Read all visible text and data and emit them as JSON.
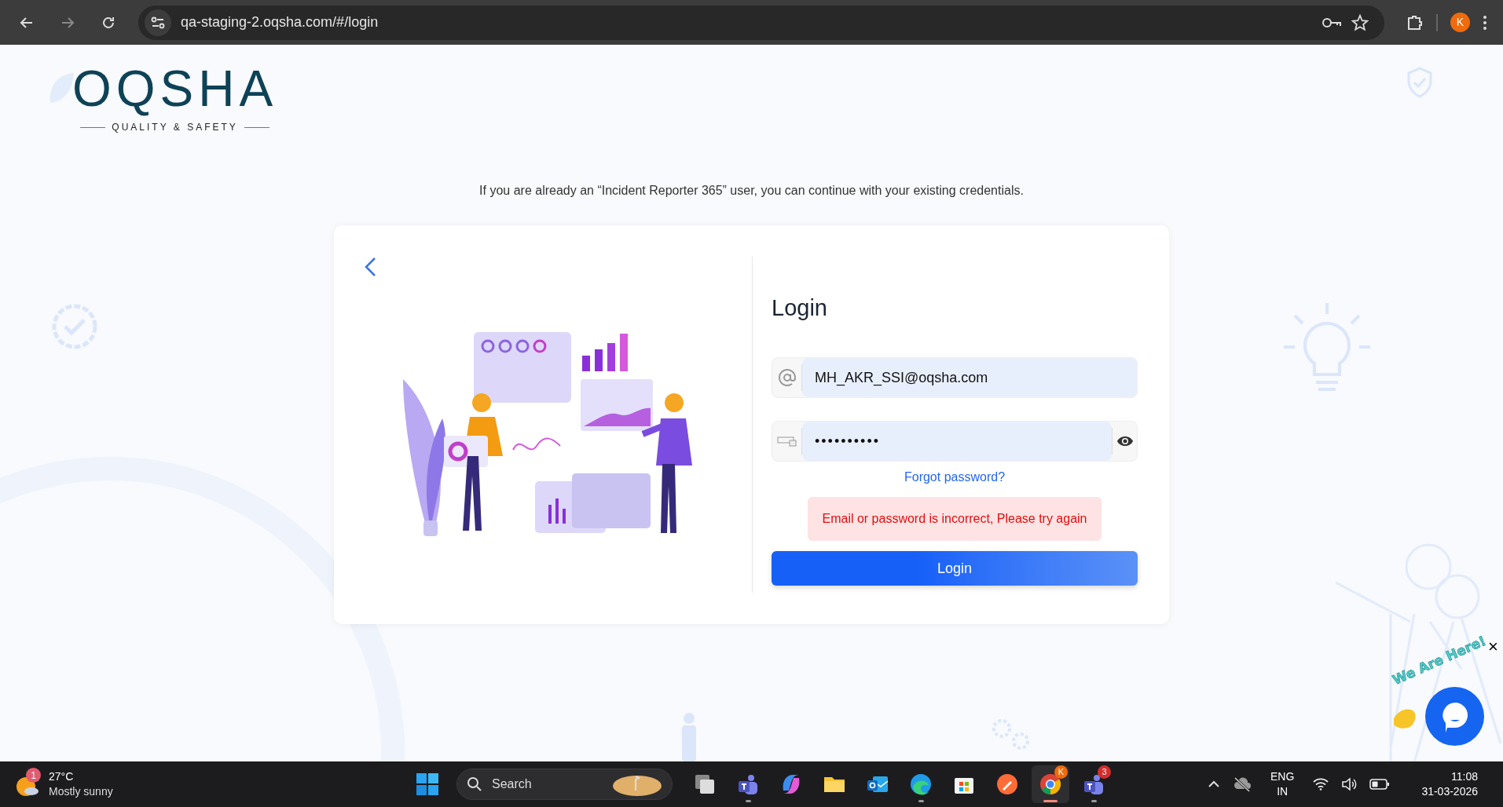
{
  "browser": {
    "url": "qa-staging-2.oqsha.com/#/login",
    "profile_initial": "K"
  },
  "logo": {
    "wordmark": "OQSHA",
    "tagline": "QUALITY & SAFETY"
  },
  "notice": "If you are already an “Incident Reporter 365” user, you can continue with your existing credentials.",
  "login_card": {
    "title": "Login",
    "email": "MH_AKR_SSI@oqsha.com",
    "password": "••••••••••",
    "forgot_link": "Forgot password?",
    "error": "Email or password is incorrect, Please try again",
    "submit": "Login"
  },
  "chat_widget": {
    "banner": "We Are Here!",
    "close": "×"
  },
  "taskbar": {
    "weather_badge": "1",
    "temperature": "27°C",
    "condition": "Mostly sunny",
    "search": "Search",
    "apps": [
      {
        "kind": "taskview",
        "running": false
      },
      {
        "kind": "teams",
        "running": true
      },
      {
        "kind": "copilot",
        "running": false
      },
      {
        "kind": "files",
        "running": false
      },
      {
        "kind": "outlook",
        "running": false
      },
      {
        "kind": "edge",
        "running": true
      },
      {
        "kind": "store",
        "running": false
      },
      {
        "kind": "postman",
        "running": false
      },
      {
        "kind": "chrome",
        "badge": "K",
        "running": true
      },
      {
        "kind": "teams",
        "badge": "3",
        "running": true
      }
    ],
    "language": "ENG",
    "region": "IN",
    "time": "11:08",
    "date": "31-03-2026"
  }
}
